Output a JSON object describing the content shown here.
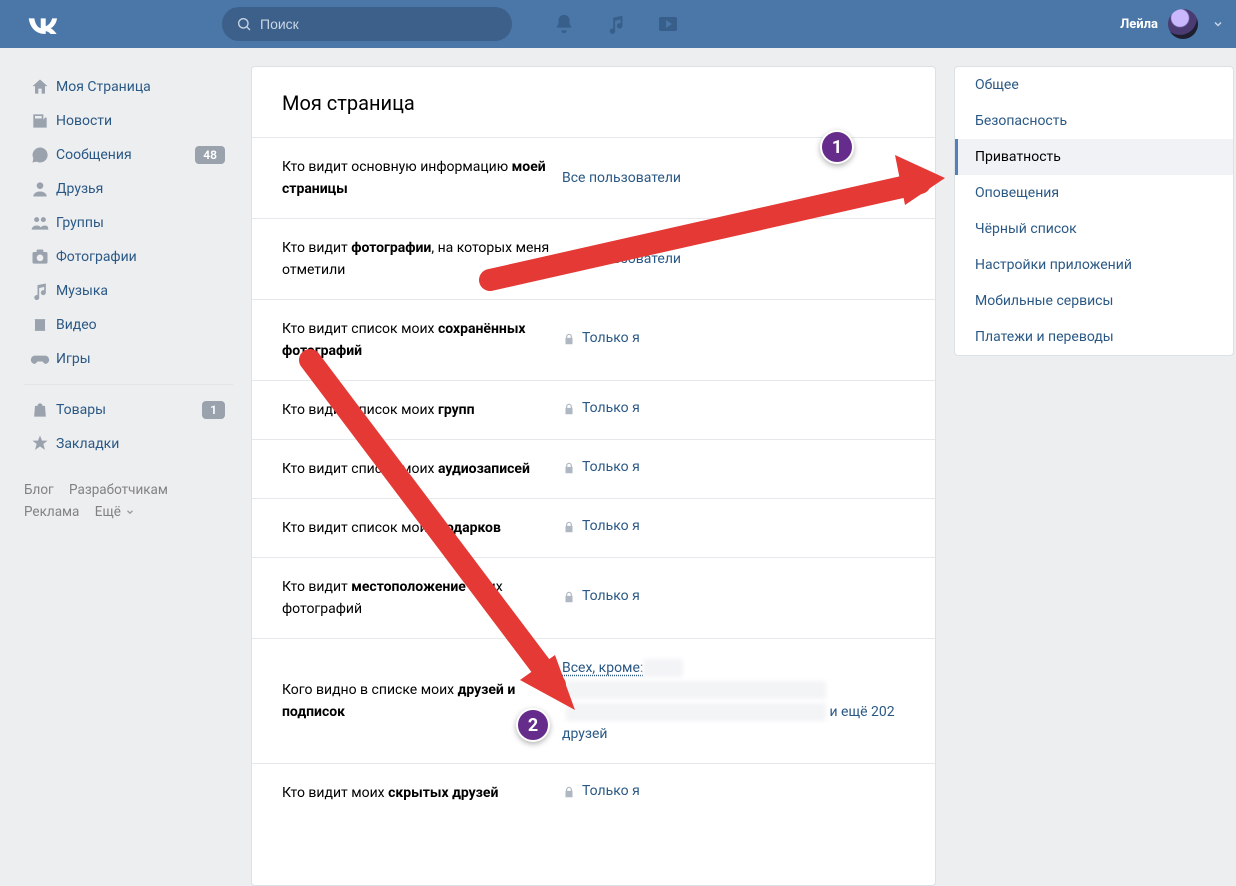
{
  "header": {
    "search_placeholder": "Поиск",
    "username": "Лейла"
  },
  "leftnav": {
    "items": [
      {
        "icon": "home-icon",
        "label": "Моя Страница"
      },
      {
        "icon": "news-icon",
        "label": "Новости"
      },
      {
        "icon": "messages-icon",
        "label": "Сообщения",
        "badge": "48"
      },
      {
        "icon": "friends-icon",
        "label": "Друзья"
      },
      {
        "icon": "groups-icon",
        "label": "Группы"
      },
      {
        "icon": "photos-icon",
        "label": "Фотографии"
      },
      {
        "icon": "music-icon",
        "label": "Музыка"
      },
      {
        "icon": "video-icon",
        "label": "Видео"
      },
      {
        "icon": "games-icon",
        "label": "Игры"
      }
    ],
    "items2": [
      {
        "icon": "market-icon",
        "label": "Товары",
        "badge": "1"
      },
      {
        "icon": "bookmarks-icon",
        "label": "Закладки"
      }
    ],
    "footer": {
      "blog": "Блог",
      "devs": "Разработчикам",
      "ads": "Реклама",
      "more": "Ещё"
    }
  },
  "main": {
    "title": "Моя страница",
    "rows": [
      {
        "label_pre": "Кто видит основную информацию ",
        "label_bold": "моей страницы",
        "value": "Все пользователи",
        "locked": false
      },
      {
        "label_pre": "Кто видит ",
        "label_bold": "фотографии",
        "label_post": ", на которых меня отметили",
        "value": "Все пользователи",
        "locked": false
      },
      {
        "label_pre": "Кто видит список моих ",
        "label_bold": "сохранённых фотографий",
        "value": "Только я",
        "locked": true
      },
      {
        "label_pre": "Кто видит список моих ",
        "label_bold": "групп",
        "value": "Только я",
        "locked": true
      },
      {
        "label_pre": "Кто видит список моих ",
        "label_bold": "аудиозаписей",
        "value": "Только я",
        "locked": true
      },
      {
        "label_pre": "Кто видит список моих ",
        "label_bold": "подарков",
        "value": "Только я",
        "locked": true
      },
      {
        "label_pre": "Кто видит ",
        "label_bold": "местоположение",
        "label_post": " моих фотографий",
        "value": "Только я",
        "locked": true
      },
      {
        "label_pre": "Кого видно в списке моих ",
        "label_bold": "друзей и подписок",
        "value_prefix": "Всех, кроме:",
        "value_tail": " и ещё 202 друзей",
        "locked": false,
        "blurred": true
      },
      {
        "label_pre": "Кто видит моих ",
        "label_bold": "скрытых друзей",
        "value": "Только я",
        "locked": true
      }
    ]
  },
  "right": {
    "items": [
      "Общее",
      "Безопасность",
      "Приватность",
      "Оповещения",
      "Чёрный список",
      "Настройки приложений",
      "Мобильные сервисы",
      "Платежи и переводы"
    ],
    "active_index": 2
  },
  "annotations": {
    "badge1": "1",
    "badge2": "2"
  }
}
